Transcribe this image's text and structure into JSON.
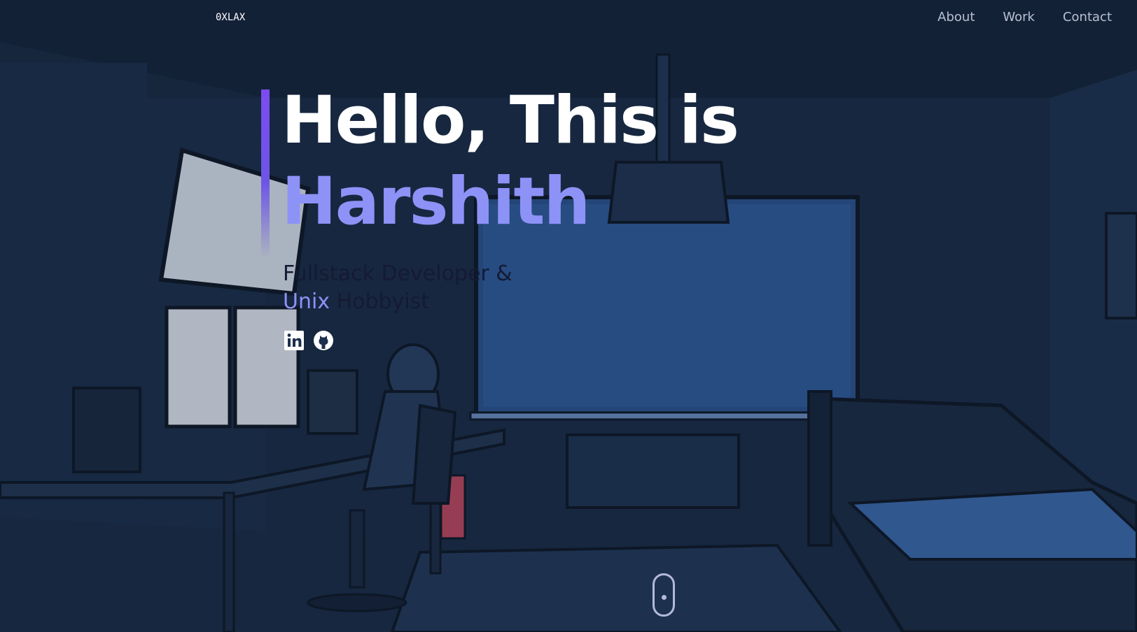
{
  "header": {
    "logo": "0XLAX",
    "nav": [
      {
        "label": "About"
      },
      {
        "label": "Work"
      },
      {
        "label": "Contact"
      }
    ]
  },
  "hero": {
    "greeting": "Hello, This is",
    "name": "Harshith",
    "subtitle_line1": "Fullstack Developer &",
    "subtitle_accent": "Unix",
    "subtitle_rest": " Hobbyist"
  },
  "socials": [
    {
      "icon": "linkedin-icon"
    },
    {
      "icon": "github-icon"
    }
  ],
  "colors": {
    "accent": "#8d92f7",
    "accent_bar": "#7b4cf0",
    "background": "#1d3150",
    "nav_text": "#b9c0d2"
  }
}
